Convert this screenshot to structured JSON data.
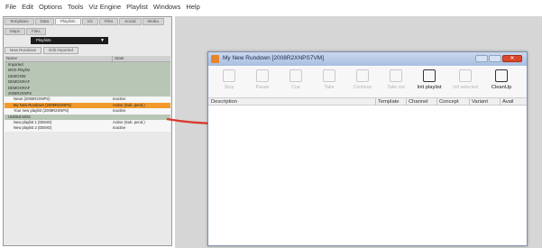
{
  "menu": [
    "File",
    "Edit",
    "Options",
    "Tools",
    "Viz Engine",
    "Playlist",
    "Windows",
    "Help"
  ],
  "left_panel": {
    "tabs": [
      {
        "label": "Templates",
        "active": false
      },
      {
        "label": "Data",
        "active": false
      },
      {
        "label": "Playlists",
        "active": true
      },
      {
        "label": "Viz",
        "active": false
      },
      {
        "label": "Files",
        "active": false
      },
      {
        "label": "Social",
        "active": false
      },
      {
        "label": "Media",
        "active": false
      },
      {
        "label": "Maps",
        "active": false
      },
      {
        "label": "Files",
        "active": false
      }
    ],
    "playlist_select": "Playlists",
    "subtabs": [
      "New Rundown",
      "Edit Imported"
    ],
    "tree_columns": [
      "Name",
      "State"
    ],
    "rows": [
      {
        "name": "Imported",
        "state": "",
        "type": "folder"
      },
      {
        "name": "MOS Playlist",
        "state": "",
        "type": "folder"
      },
      {
        "name": "DEMONW",
        "state": "",
        "type": "folder"
      },
      {
        "name": "DEMOGRAF",
        "state": "",
        "type": "folder"
      },
      {
        "name": "DEMOGRAF",
        "state": "",
        "type": "folder"
      },
      {
        "name": "2008R2XNPS",
        "state": "",
        "type": "folder"
      },
      {
        "name": "News (2008R2XNPS)",
        "state": "Inactive",
        "type": "plain"
      },
      {
        "name": "My New Rundown (2008R2XNPS)",
        "state": "Active (Sub. pend.)",
        "type": "sel"
      },
      {
        "name": "Your new playlist (2008R2XNPS)",
        "state": "Inactive",
        "type": "plain"
      },
      {
        "name": "Untitled MOS",
        "state": "",
        "type": "folder"
      },
      {
        "name": "New playlist 1 (DEMO)",
        "state": "Active (Sub. pend.)",
        "type": "plain"
      },
      {
        "name": "New playlist 2 (DEMO)",
        "state": "Inactive",
        "type": "plain"
      }
    ]
  },
  "rundown_window": {
    "title": "My New Rundown [2008R2XNPS7VM]",
    "toolbar": [
      {
        "label": "Stop",
        "icon": "stop-icon",
        "enabled": false
      },
      {
        "label": "Pause",
        "icon": "pause-icon",
        "enabled": false
      },
      {
        "label": "Cue",
        "icon": "cue-icon",
        "enabled": false
      },
      {
        "label": "Take",
        "icon": "take-icon",
        "enabled": false
      },
      {
        "label": "Continue",
        "icon": "continue-icon",
        "enabled": false
      },
      {
        "label": "Take out",
        "icon": "take-out-icon",
        "enabled": false
      },
      {
        "label": "Init playlist",
        "icon": "init-playlist-icon",
        "enabled": true
      },
      {
        "label": "Init selected",
        "icon": "init-selected-icon",
        "enabled": false
      },
      {
        "label": "CleanUp",
        "icon": "cleanup-icon",
        "enabled": true
      }
    ],
    "columns": [
      "Description",
      "Template",
      "Channel",
      "Concept",
      "Variant",
      "Avail"
    ]
  },
  "colors": {
    "selected_row": "#f19a2b",
    "folder_row": "#b8c6b6",
    "arrow": "#d93b2b",
    "close_button": "#d9482b"
  }
}
